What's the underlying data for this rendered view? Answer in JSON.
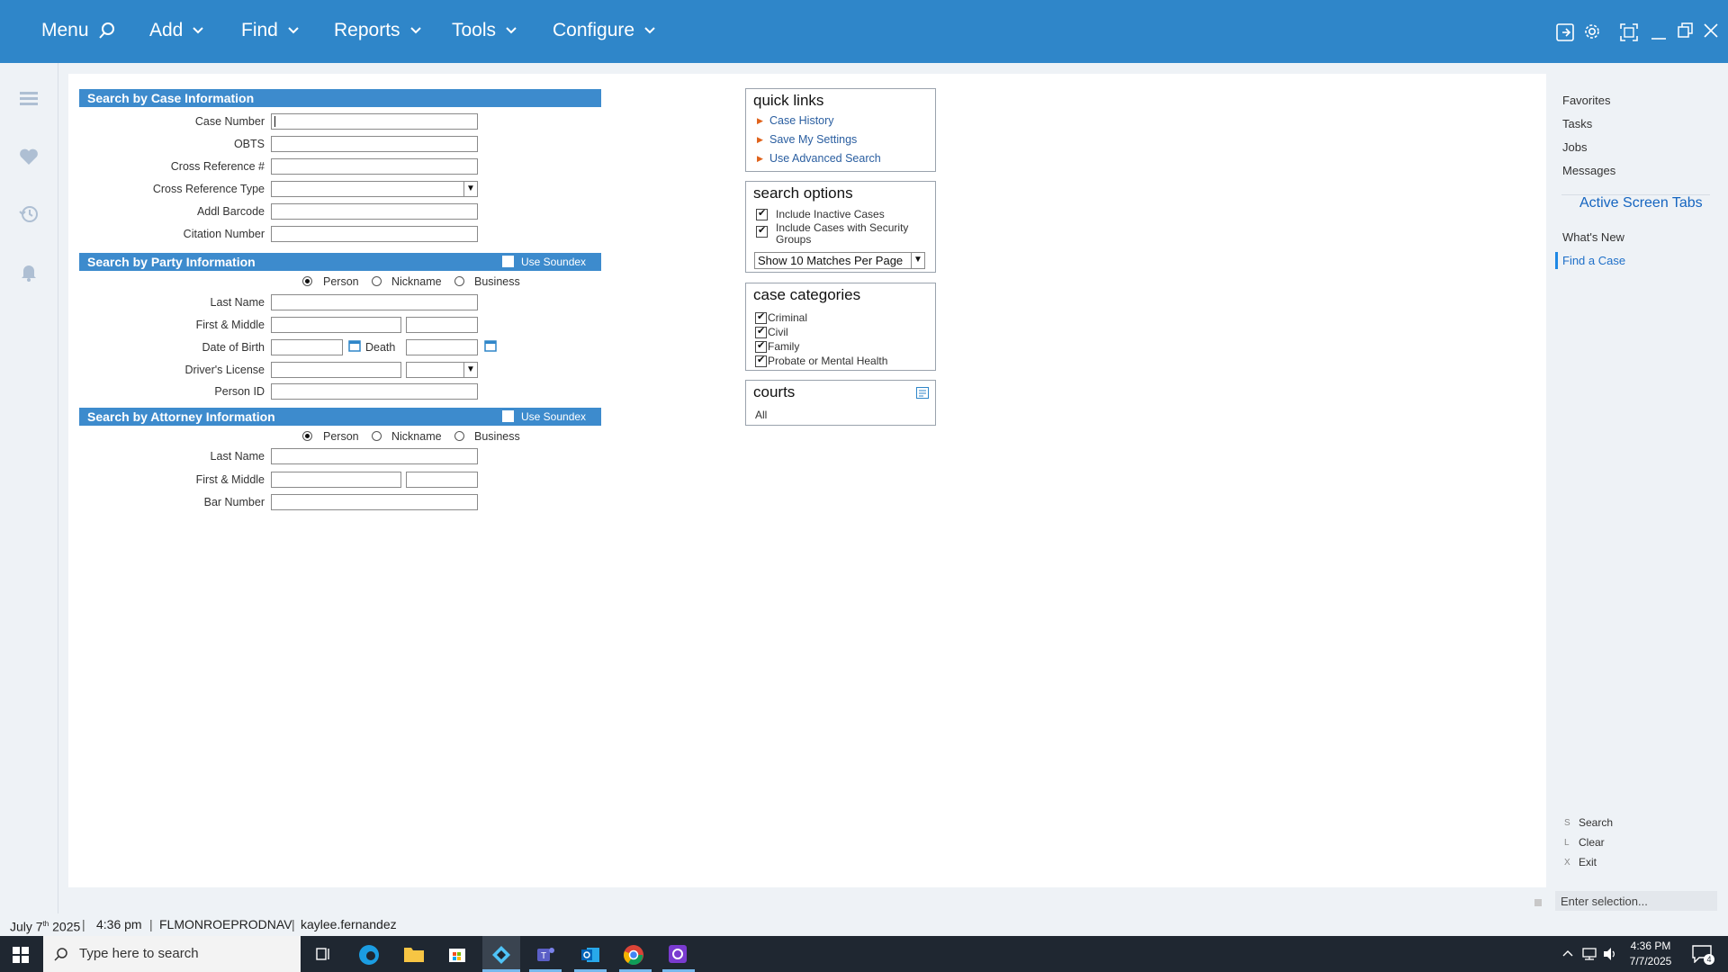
{
  "topbar": {
    "menu_label": "Menu",
    "add_label": "Add",
    "find_label": "Find",
    "reports_label": "Reports",
    "tools_label": "Tools",
    "configure_label": "Configure"
  },
  "case_section": {
    "title": "Search by Case Information",
    "case_number_label": "Case Number",
    "obts_label": "OBTS",
    "cross_reference_label": "Cross Reference #",
    "cross_reference_type_label": "Cross Reference Type",
    "addl_barcode_label": "Addl Barcode",
    "citation_number_label": "Citation Number"
  },
  "party_section": {
    "title": "Search by Party Information",
    "soundex_label": "Use Soundex",
    "radio_person": "Person",
    "radio_nickname": "Nickname",
    "radio_business": "Business",
    "last_name_label": "Last Name",
    "first_middle_label": "First & Middle",
    "dob_label": "Date of Birth",
    "death_label": "Death",
    "drivers_license_label": "Driver's License",
    "person_id_label": "Person ID"
  },
  "attorney_section": {
    "title": "Search by Attorney Information",
    "soundex_label": "Use Soundex",
    "radio_person": "Person",
    "radio_nickname": "Nickname",
    "radio_business": "Business",
    "last_name_label": "Last Name",
    "first_middle_label": "First & Middle",
    "bar_number_label": "Bar Number"
  },
  "quick_links": {
    "title": "quick links",
    "items": [
      "Case History",
      "Save My Settings",
      "Use Advanced Search"
    ]
  },
  "search_options": {
    "title": "search options",
    "inactive_label": "Include Inactive Cases",
    "security_label_1": "Include Cases with Security",
    "security_label_2": "Groups",
    "matches_value": "Show 10 Matches Per Page"
  },
  "case_categories": {
    "title": "case categories",
    "items": [
      "Criminal",
      "Civil",
      "Family",
      "Probate or Mental Health"
    ]
  },
  "courts": {
    "title": "courts",
    "value": "All"
  },
  "right_panel": {
    "links": [
      "Favorites",
      "Tasks",
      "Jobs",
      "Messages"
    ],
    "active_tabs_title": "Active Screen Tabs",
    "whats_new": "What's New",
    "find_a_case": "Find a Case",
    "actions": [
      {
        "key": "S",
        "label": "Search"
      },
      {
        "key": "L",
        "label": "Clear"
      },
      {
        "key": "X",
        "label": "Exit"
      }
    ],
    "selection_placeholder": "Enter selection..."
  },
  "status_bar": {
    "date": "July 7",
    "date_sup": "th",
    "year": "2025",
    "time": "4:36 pm",
    "server": "FLMONROEPRODNAV",
    "user": "kaylee.fernandez"
  },
  "taskbar": {
    "search_placeholder": "Type here to search",
    "clock_time": "4:36 PM",
    "clock_date": "7/7/2025",
    "notification_count": "4"
  },
  "colors": {
    "topbar": "#2f86c9",
    "section_header": "#3d8bcd",
    "link": "#2a5ea0",
    "active_tab": "#1565c0",
    "taskbar": "#1f2731"
  }
}
